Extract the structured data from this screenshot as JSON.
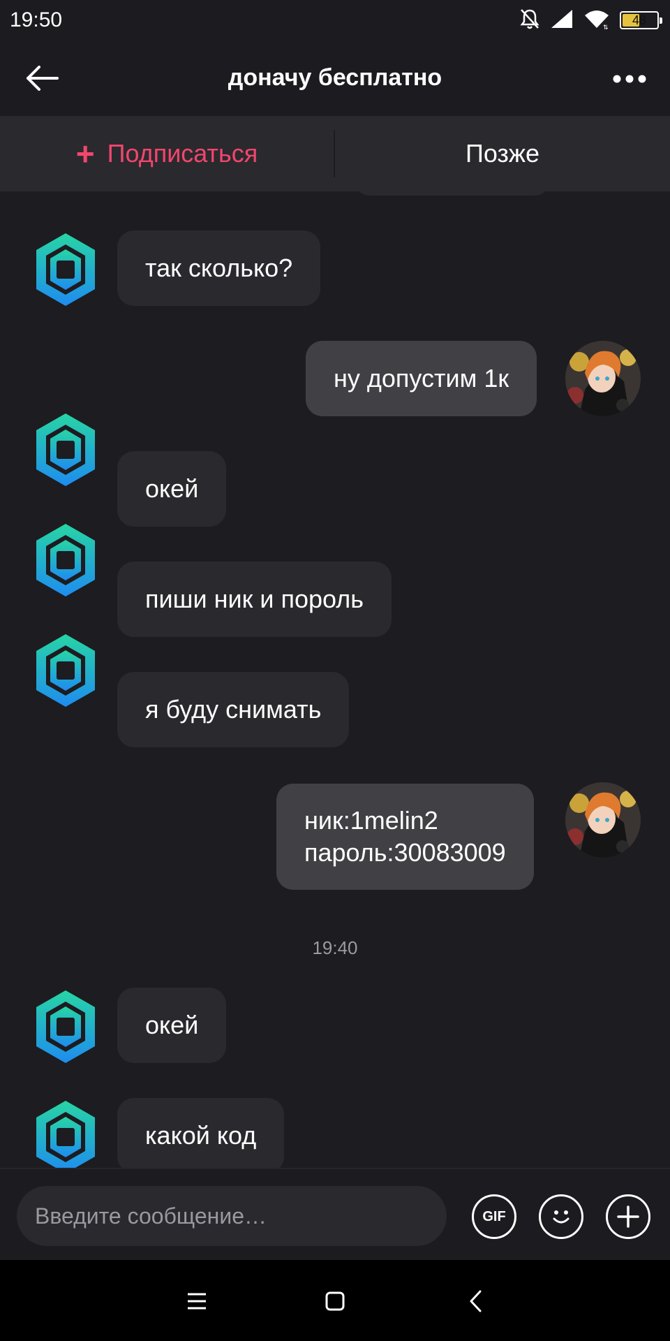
{
  "status_bar": {
    "time": "19:50",
    "battery_level": "48",
    "icons": [
      "bell-off-icon",
      "signal-icon",
      "wifi-icon",
      "battery-icon"
    ]
  },
  "header": {
    "title": "доначу бесплатно",
    "back_icon": "arrow-left-icon",
    "more_icon": "more-dots-icon"
  },
  "subscribe_bar": {
    "subscribe_label": "Подписаться",
    "later_label": "Позже",
    "accent_color": "#f2466d"
  },
  "chat": {
    "messages": [
      {
        "from": "other",
        "text": "так сколько?"
      },
      {
        "from": "me",
        "text": "ну допустим 1к"
      },
      {
        "from": "other",
        "text": "окей"
      },
      {
        "from": "other",
        "text": "пиши ник и пороль"
      },
      {
        "from": "other",
        "text": "я буду снимать"
      },
      {
        "from": "me",
        "text": "ник:1melin2\nпароль:30083009"
      },
      {
        "from": "other",
        "text": "окей"
      },
      {
        "from": "other",
        "text": "какой код"
      }
    ],
    "time_separator": "19:40"
  },
  "input_bar": {
    "placeholder": "Введите сообщение…",
    "gif_label": "GIF",
    "icons": [
      "gif-icon",
      "emoji-icon",
      "add-icon"
    ]
  },
  "nav_bar": {
    "icons": [
      "menu-icon",
      "home-icon",
      "back-icon"
    ]
  },
  "colors": {
    "background": "#1d1c20",
    "incoming_bubble": "#2a292e",
    "outgoing_bubble": "#414045",
    "avatar_gradient_top": "#27d5a4",
    "avatar_gradient_bottom": "#1e8cf0"
  }
}
